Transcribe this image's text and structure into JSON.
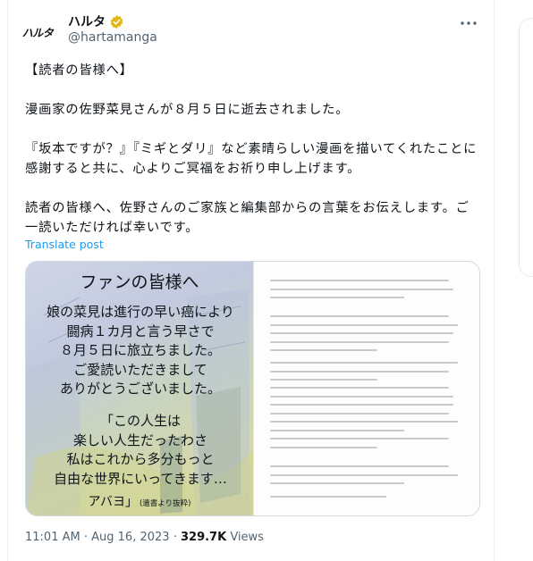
{
  "author": {
    "display_name": "ハルタ",
    "handle": "@hartamanga",
    "avatar_text": "ハルタ",
    "verified_color": "#e2b719"
  },
  "tweet": {
    "paragraphs": [
      "【読者の皆様へ】",
      "漫画家の佐野菜見さんが８月５日に逝去されました。",
      "『坂本ですが？』『ミギとダリ』など素晴らしい漫画を描いてくれたことに感謝すると共に、心よりご冥福をお祈り申し上げます。",
      "読者の皆様へ、佐野さんのご家族と編集部からの言葉をお伝えします。ご一読いただければ幸いです。"
    ],
    "translate_label": "Translate post",
    "time": "11:01 AM",
    "date": "Aug 16, 2023",
    "views_count": "329.7K",
    "views_label": "Views",
    "separator": "·"
  },
  "media": {
    "left_image": {
      "title": "ファンの皆様へ",
      "body_lines": [
        "娘の菜見は進行の早い癌により",
        "闘病１カ月と言う早さで",
        "８月５日に旅立ちました。",
        "ご愛読いただきまして",
        "ありがとうございました。"
      ],
      "quote_lines": [
        "「この人生は",
        "楽しい人生だったわさ",
        "私はこれから多分もっと",
        "自由な世界にいってきます…"
      ],
      "signature": "アバヨ」",
      "signature_note": "(遺書より抜粋)"
    }
  },
  "icons": {
    "verified": "verified-badge-icon",
    "more": "more-options-icon"
  },
  "accent_color": "#1d9bf0"
}
